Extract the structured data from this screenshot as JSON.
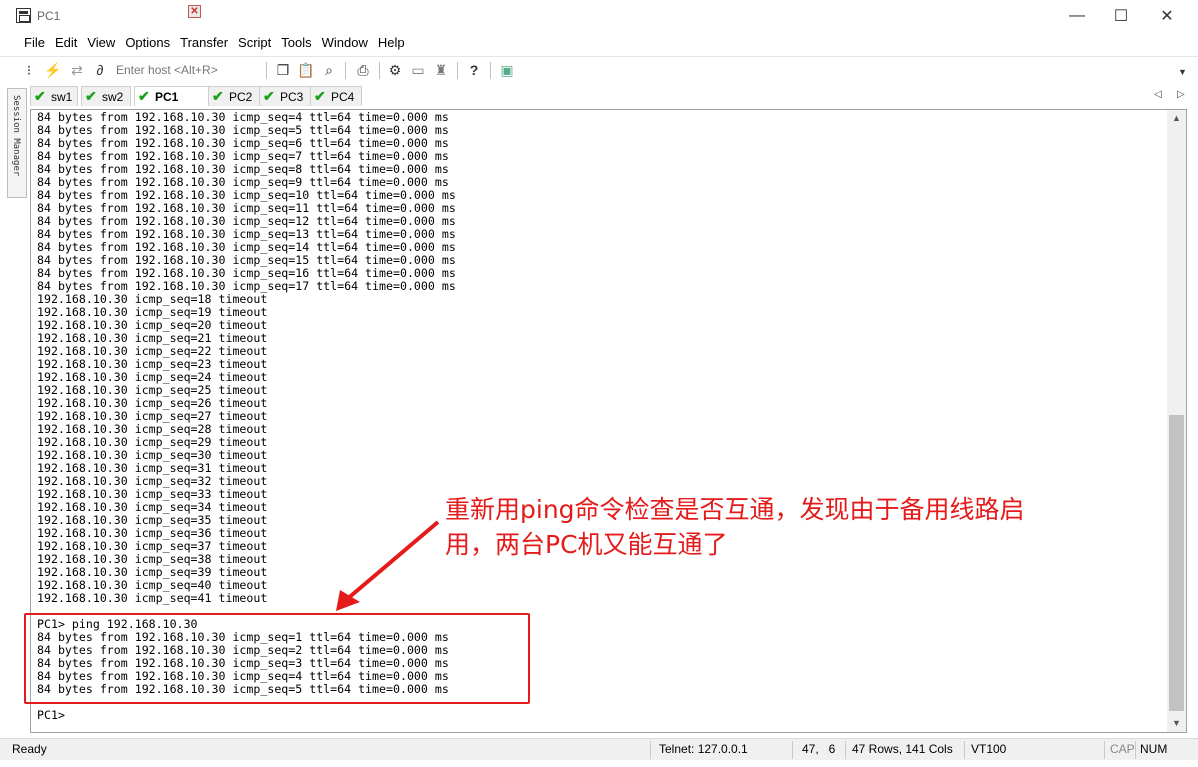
{
  "window": {
    "title": "PC1"
  },
  "title_controls": {
    "minimize": "—",
    "maximize": "☐",
    "close": "✕"
  },
  "menu": [
    "File",
    "Edit",
    "View",
    "Options",
    "Transfer",
    "Script",
    "Tools",
    "Window",
    "Help"
  ],
  "toolbar": {
    "host_placeholder": "Enter host <Alt+R>",
    "icons": [
      "connect-tree-icon",
      "lightning-icon",
      "reconnect-icon",
      "disconnect-icon",
      "copy-icon",
      "paste-icon",
      "find-icon",
      "print-icon",
      "settings-icon",
      "keymap-icon",
      "sftp-icon",
      "help-icon",
      "script-icon"
    ]
  },
  "side_panel": {
    "label": "Session Manager"
  },
  "tabs": [
    {
      "label": "sw1",
      "active": false
    },
    {
      "label": "sw2",
      "active": false
    },
    {
      "label": "PC1",
      "active": true
    },
    {
      "label": "PC2",
      "active": false
    },
    {
      "label": "PC3",
      "active": false
    },
    {
      "label": "PC4",
      "active": false
    }
  ],
  "terminal": {
    "lines": [
      "84 bytes from 192.168.10.30 icmp_seq=4 ttl=64 time=0.000 ms",
      "84 bytes from 192.168.10.30 icmp_seq=5 ttl=64 time=0.000 ms",
      "84 bytes from 192.168.10.30 icmp_seq=6 ttl=64 time=0.000 ms",
      "84 bytes from 192.168.10.30 icmp_seq=7 ttl=64 time=0.000 ms",
      "84 bytes from 192.168.10.30 icmp_seq=8 ttl=64 time=0.000 ms",
      "84 bytes from 192.168.10.30 icmp_seq=9 ttl=64 time=0.000 ms",
      "84 bytes from 192.168.10.30 icmp_seq=10 ttl=64 time=0.000 ms",
      "84 bytes from 192.168.10.30 icmp_seq=11 ttl=64 time=0.000 ms",
      "84 bytes from 192.168.10.30 icmp_seq=12 ttl=64 time=0.000 ms",
      "84 bytes from 192.168.10.30 icmp_seq=13 ttl=64 time=0.000 ms",
      "84 bytes from 192.168.10.30 icmp_seq=14 ttl=64 time=0.000 ms",
      "84 bytes from 192.168.10.30 icmp_seq=15 ttl=64 time=0.000 ms",
      "84 bytes from 192.168.10.30 icmp_seq=16 ttl=64 time=0.000 ms",
      "84 bytes from 192.168.10.30 icmp_seq=17 ttl=64 time=0.000 ms",
      "192.168.10.30 icmp_seq=18 timeout",
      "192.168.10.30 icmp_seq=19 timeout",
      "192.168.10.30 icmp_seq=20 timeout",
      "192.168.10.30 icmp_seq=21 timeout",
      "192.168.10.30 icmp_seq=22 timeout",
      "192.168.10.30 icmp_seq=23 timeout",
      "192.168.10.30 icmp_seq=24 timeout",
      "192.168.10.30 icmp_seq=25 timeout",
      "192.168.10.30 icmp_seq=26 timeout",
      "192.168.10.30 icmp_seq=27 timeout",
      "192.168.10.30 icmp_seq=28 timeout",
      "192.168.10.30 icmp_seq=29 timeout",
      "192.168.10.30 icmp_seq=30 timeout",
      "192.168.10.30 icmp_seq=31 timeout",
      "192.168.10.30 icmp_seq=32 timeout",
      "192.168.10.30 icmp_seq=33 timeout",
      "192.168.10.30 icmp_seq=34 timeout",
      "192.168.10.30 icmp_seq=35 timeout",
      "192.168.10.30 icmp_seq=36 timeout",
      "192.168.10.30 icmp_seq=37 timeout",
      "192.168.10.30 icmp_seq=38 timeout",
      "192.168.10.30 icmp_seq=39 timeout",
      "192.168.10.30 icmp_seq=40 timeout",
      "192.168.10.30 icmp_seq=41 timeout",
      "",
      "PC1> ping 192.168.10.30",
      "84 bytes from 192.168.10.30 icmp_seq=1 ttl=64 time=0.000 ms",
      "84 bytes from 192.168.10.30 icmp_seq=2 ttl=64 time=0.000 ms",
      "84 bytes from 192.168.10.30 icmp_seq=3 ttl=64 time=0.000 ms",
      "84 bytes from 192.168.10.30 icmp_seq=4 ttl=64 time=0.000 ms",
      "84 bytes from 192.168.10.30 icmp_seq=5 ttl=64 time=0.000 ms",
      "",
      "PC1>"
    ]
  },
  "annotation": {
    "text_line1": "重新用ping命令检查是否互通，发现由于备用线路启",
    "text_line2": "用，两台PC机又能互通了",
    "color": "#e51b1b"
  },
  "status": {
    "left": "Ready",
    "connection": "Telnet: 127.0.0.1",
    "position": "47,   6",
    "size": "47 Rows, 141 Cols",
    "emulation": "VT100",
    "cap": "CAP",
    "num": "NUM"
  }
}
